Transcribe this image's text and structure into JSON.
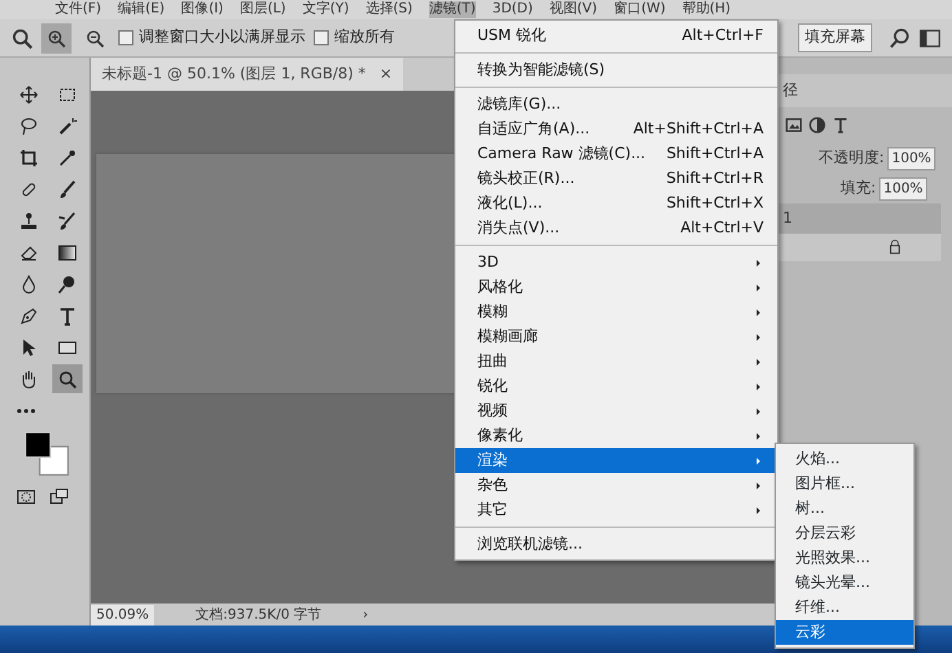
{
  "menu_bar": [
    {
      "label": "文件(F)",
      "selected": false
    },
    {
      "label": "编辑(E)",
      "selected": false
    },
    {
      "label": "图像(I)",
      "selected": false
    },
    {
      "label": "图层(L)",
      "selected": false
    },
    {
      "label": "文字(Y)",
      "selected": false
    },
    {
      "label": "选择(S)",
      "selected": false
    },
    {
      "label": "滤镜(T)",
      "selected": true
    },
    {
      "label": "3D(D)",
      "selected": false
    },
    {
      "label": "视图(V)",
      "selected": false
    },
    {
      "label": "窗口(W)",
      "selected": false
    },
    {
      "label": "帮助(H)",
      "selected": false
    }
  ],
  "options_bar": {
    "zoom_in_selected": true,
    "checkboxes": [
      {
        "label": "调整窗口大小以满屏显示",
        "checked": false
      },
      {
        "label": "缩放所有",
        "checked": false
      }
    ],
    "fill_screen_button": "填充屏幕"
  },
  "document_tab": {
    "title": "未标题-1 @ 50.1% (图层 1, RGB/8) *",
    "close": "×"
  },
  "toolbar": {
    "tools": [
      {
        "selected": false
      },
      {
        "selected": false
      },
      {
        "selected": false
      },
      {
        "selected": false
      },
      {
        "selected": false
      },
      {
        "selected": false
      },
      {
        "selected": false
      },
      {
        "selected": false
      },
      {
        "selected": false
      },
      {
        "selected": false
      },
      {
        "selected": false
      },
      {
        "selected": false
      },
      {
        "selected": false
      },
      {
        "selected": false
      },
      {
        "selected": false
      },
      {
        "selected": false
      },
      {
        "selected": false
      },
      {
        "selected": false
      },
      {
        "selected": false
      },
      {
        "selected": true
      }
    ]
  },
  "status_bar": {
    "zoom": "50.09%",
    "doc_info": "文档:937.5K/0 字节",
    "arrow": "›"
  },
  "layers_panel": {
    "tab": "径",
    "opacity_label": "不透明度:",
    "opacity": "100%",
    "fill_label": "填充:",
    "fill": "100%",
    "layer_name": "1"
  },
  "filter_menu": {
    "items": [
      {
        "kind": "item",
        "label": "USM 锐化",
        "shortcut": "Alt+Ctrl+F"
      },
      {
        "kind": "separator"
      },
      {
        "kind": "item",
        "label": "转换为智能滤镜(S)"
      },
      {
        "kind": "separator"
      },
      {
        "kind": "item",
        "label": "滤镜库(G)..."
      },
      {
        "kind": "item",
        "label": "自适应广角(A)...",
        "shortcut": "Alt+Shift+Ctrl+A"
      },
      {
        "kind": "item",
        "label": "Camera Raw 滤镜(C)...",
        "shortcut": "Shift+Ctrl+A"
      },
      {
        "kind": "item",
        "label": "镜头校正(R)...",
        "shortcut": "Shift+Ctrl+R"
      },
      {
        "kind": "item",
        "label": "液化(L)...",
        "shortcut": "Shift+Ctrl+X"
      },
      {
        "kind": "item",
        "label": "消失点(V)...",
        "shortcut": "Alt+Ctrl+V"
      },
      {
        "kind": "separator"
      },
      {
        "kind": "submenu",
        "label": "3D",
        "selected": false
      },
      {
        "kind": "submenu",
        "label": "风格化",
        "selected": false
      },
      {
        "kind": "submenu",
        "label": "模糊",
        "selected": false
      },
      {
        "kind": "submenu",
        "label": "模糊画廊",
        "selected": false
      },
      {
        "kind": "submenu",
        "label": "扭曲",
        "selected": false
      },
      {
        "kind": "submenu",
        "label": "锐化",
        "selected": false
      },
      {
        "kind": "submenu",
        "label": "视频",
        "selected": false
      },
      {
        "kind": "submenu",
        "label": "像素化",
        "selected": false
      },
      {
        "kind": "submenu",
        "label": "渲染",
        "selected": true
      },
      {
        "kind": "submenu",
        "label": "杂色",
        "selected": false
      },
      {
        "kind": "submenu",
        "label": "其它",
        "selected": false
      },
      {
        "kind": "separator"
      },
      {
        "kind": "item",
        "label": "浏览联机滤镜..."
      }
    ]
  },
  "render_submenu": {
    "items": [
      {
        "label": "火焰...",
        "selected": false
      },
      {
        "label": "图片框...",
        "selected": false
      },
      {
        "label": "树...",
        "selected": false
      },
      {
        "label": "分层云彩",
        "selected": false
      },
      {
        "label": "光照效果...",
        "selected": false
      },
      {
        "label": "镜头光晕...",
        "selected": false
      },
      {
        "label": "纤维...",
        "selected": false
      },
      {
        "label": "云彩",
        "selected": true
      }
    ]
  }
}
